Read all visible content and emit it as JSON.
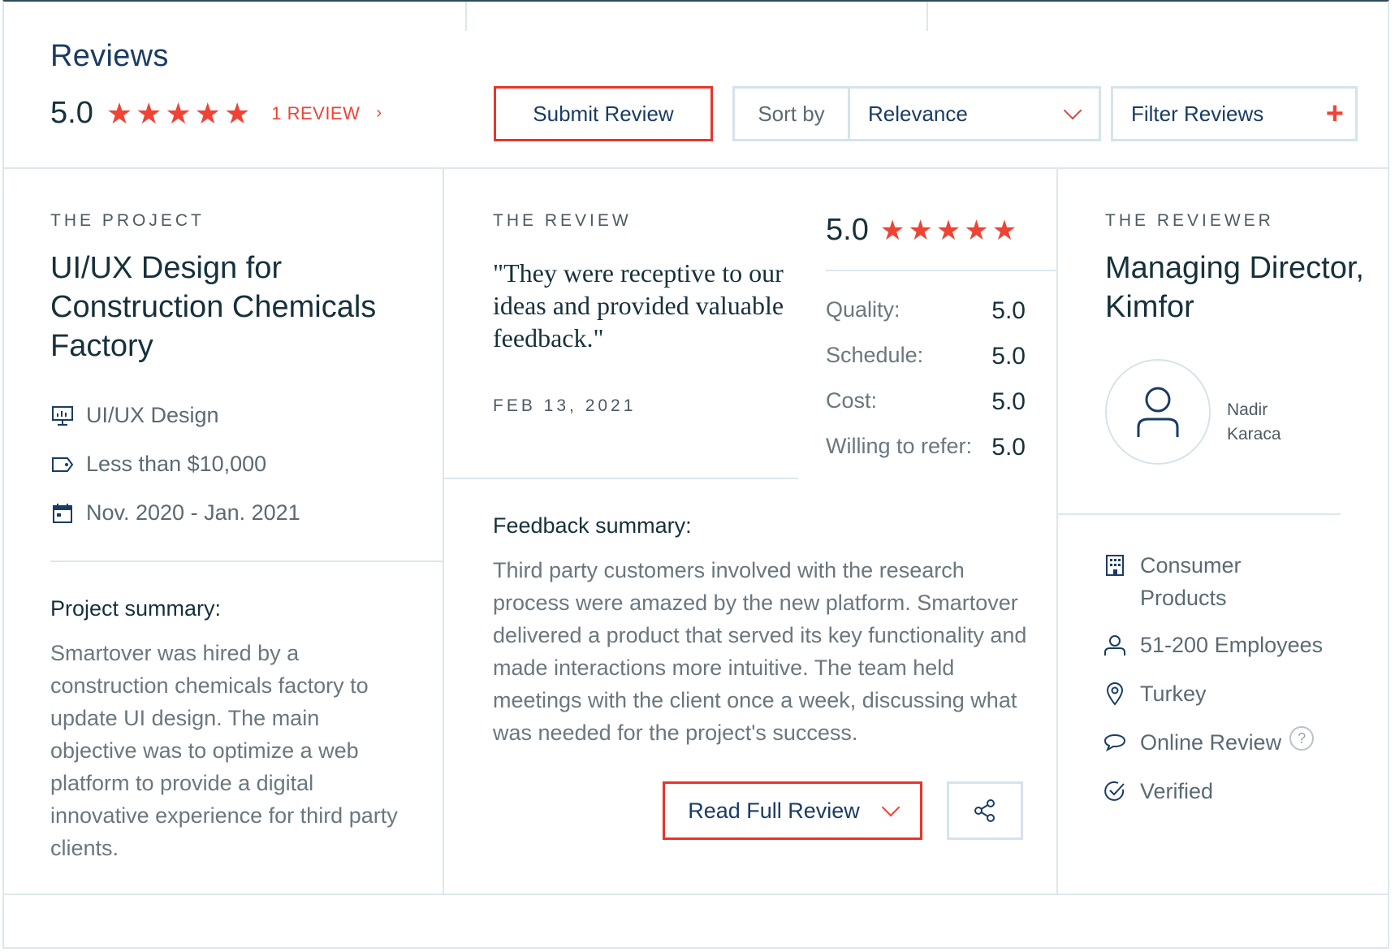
{
  "header": {
    "title": "Reviews",
    "rating": "5.0",
    "review_count_link": "1 REVIEW",
    "submit_label": "Submit Review",
    "sort_label": "Sort by",
    "sort_value": "Relevance",
    "filter_label": "Filter Reviews"
  },
  "project": {
    "eyebrow": "THE PROJECT",
    "title": "UI/UX Design for Construction Chemicals Factory",
    "service": "UI/UX Design",
    "budget": "Less than $10,000",
    "dates": "Nov. 2020 - Jan. 2021",
    "summary_heading": "Project summary:",
    "summary": "Smartover was hired by a construction chemicals factory to update UI design. The main objective was to optimize a web platform to provide a digital innovative experience for third party clients."
  },
  "review": {
    "eyebrow": "THE REVIEW",
    "quote": "\"They were receptive to our ideas and provided valuable feedback.\"",
    "date": "FEB 13, 2021",
    "overall": "5.0",
    "scores": [
      {
        "label": "Quality:",
        "value": "5.0"
      },
      {
        "label": "Schedule:",
        "value": "5.0"
      },
      {
        "label": "Cost:",
        "value": "5.0"
      },
      {
        "label": "Willing to refer:",
        "value": "5.0"
      }
    ],
    "feedback_heading": "Feedback summary:",
    "feedback": "Third party customers involved with the research process were amazed by the new platform. Smartover delivered a product that served its key functionality and made interactions more intuitive. The team held meetings with the client once a week, discussing what was needed for the project's success.",
    "read_full_label": "Read Full Review"
  },
  "reviewer": {
    "eyebrow": "THE REVIEWER",
    "title": "Managing Director, Kimfor",
    "name": "Nadir Karaca",
    "industry": "Consumer Products",
    "size": "51-200 Employees",
    "location": "Turkey",
    "review_type": "Online Review",
    "help_glyph": "?",
    "verified": "Verified"
  },
  "colors": {
    "accent": "#ef4335",
    "title_blue": "#1a3c64",
    "border": "#d6e3ea"
  },
  "icons": [
    "star-icon",
    "chevron-right-icon",
    "chevron-down-icon",
    "plus-icon",
    "presentation-icon",
    "price-tag-icon",
    "calendar-icon",
    "share-icon",
    "user-icon",
    "building-icon",
    "location-pin-icon",
    "chat-bubble-icon",
    "help-icon",
    "check-circle-icon"
  ]
}
